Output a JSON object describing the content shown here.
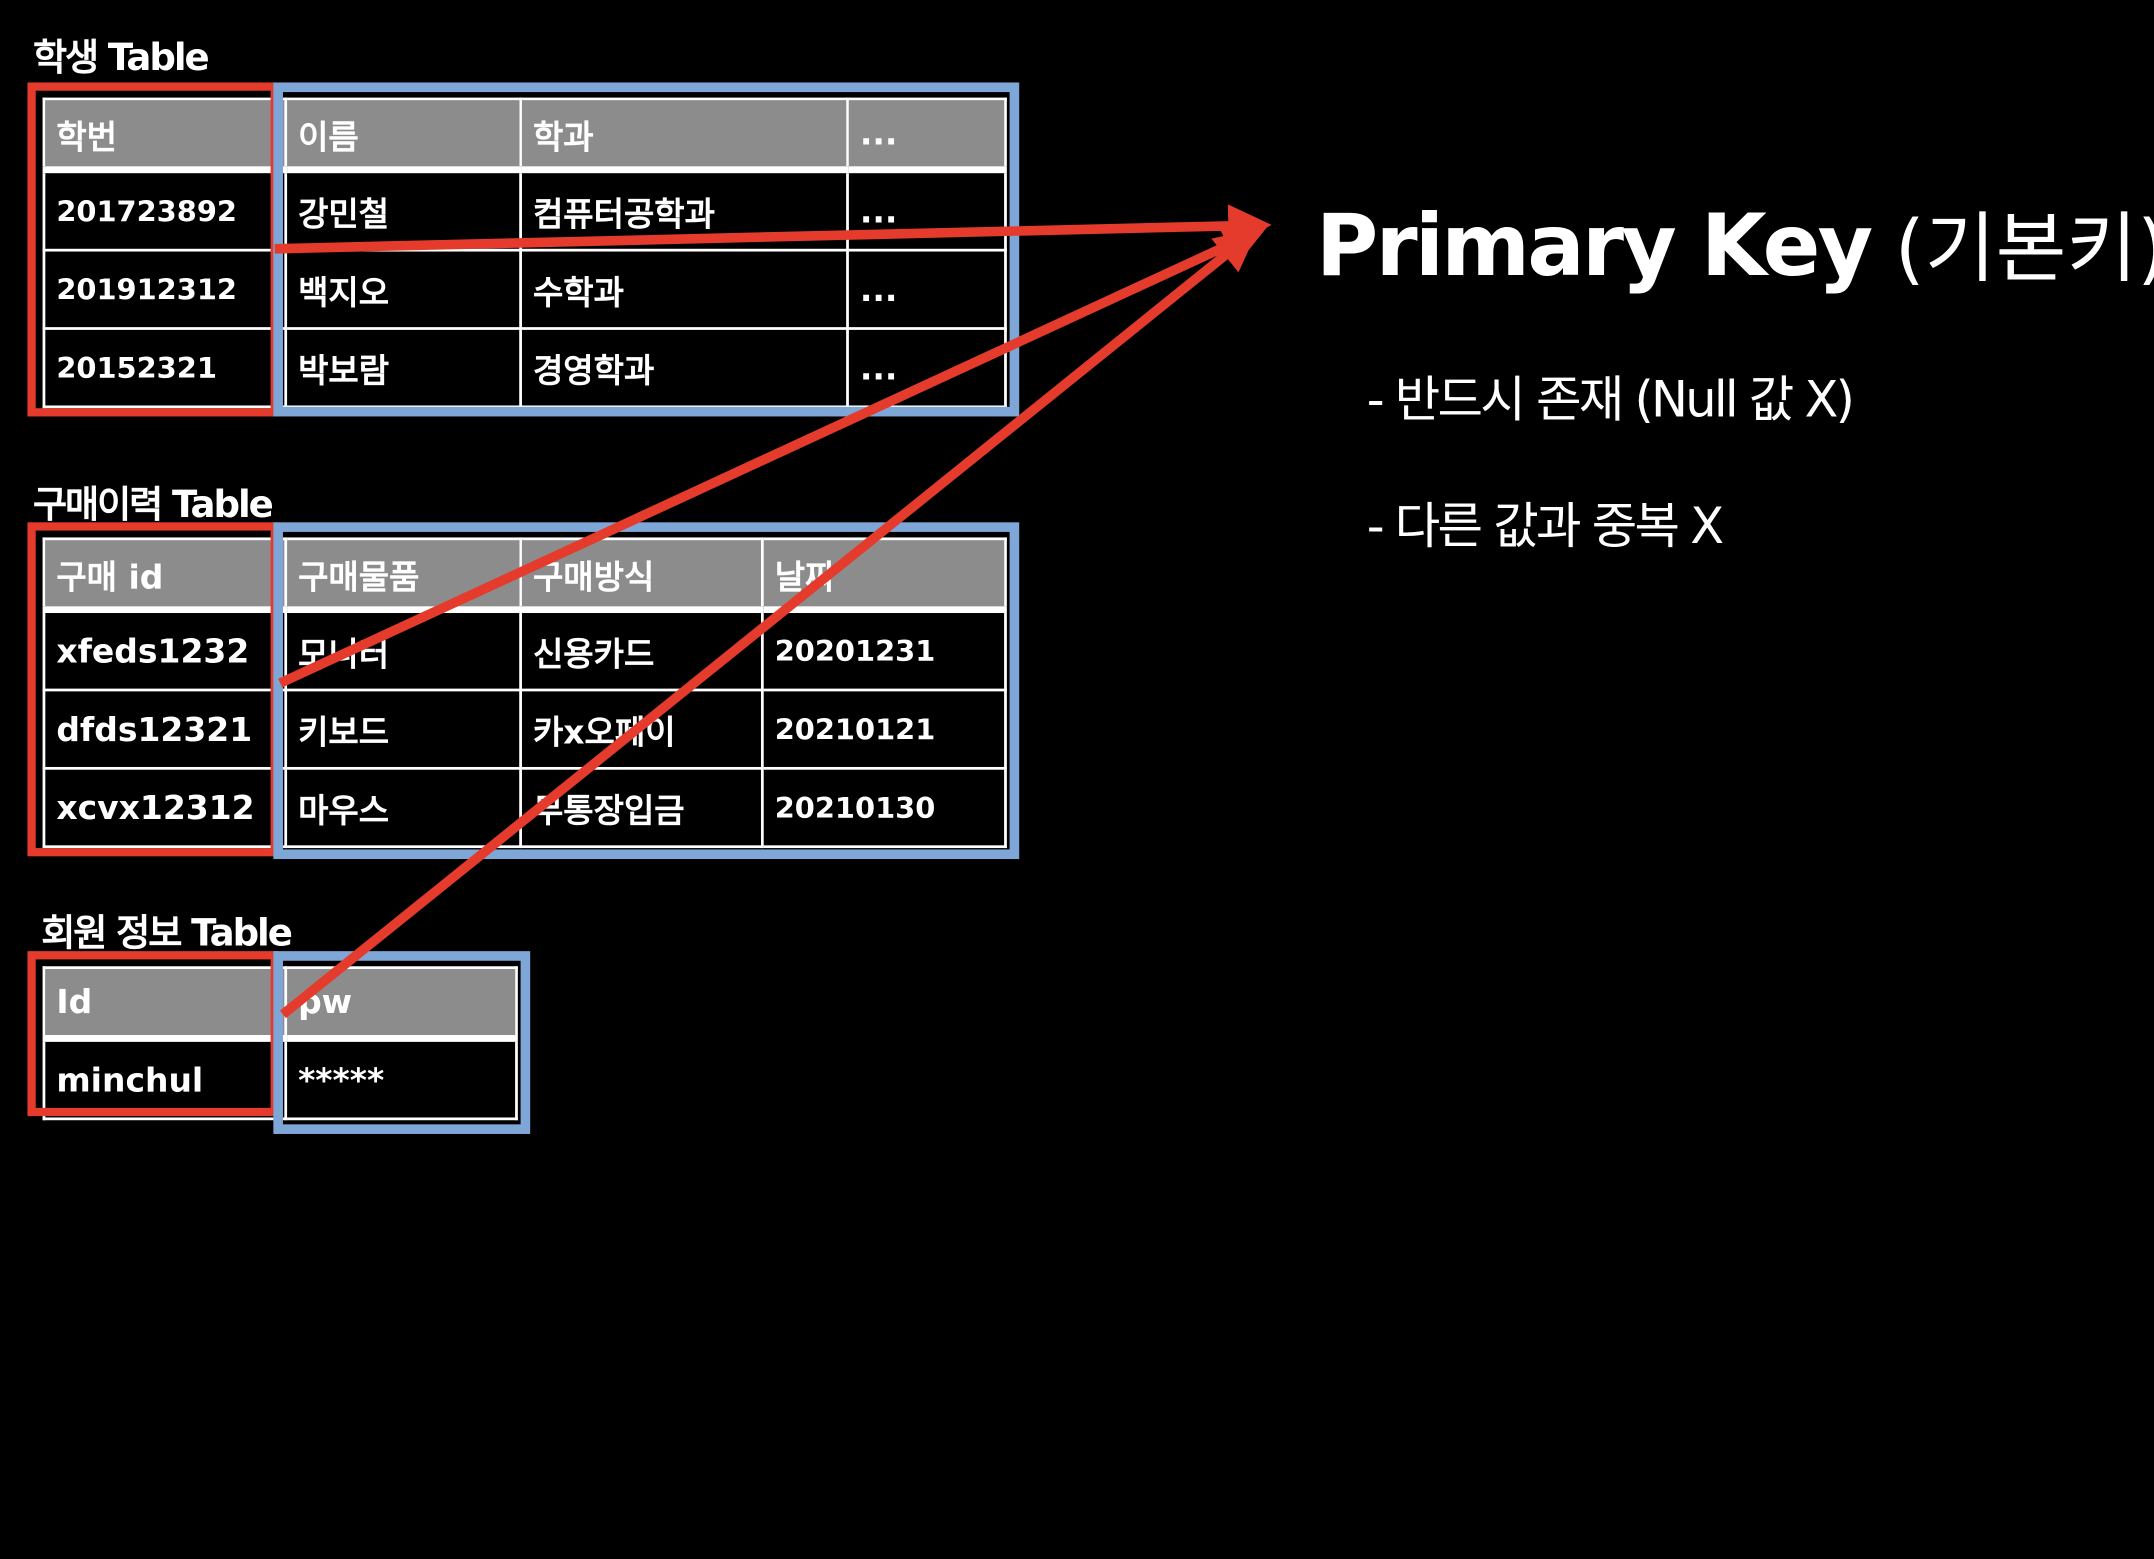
{
  "student_table": {
    "caption": "학생 Table",
    "headers": [
      "학번",
      "이름",
      "학과",
      "..."
    ],
    "rows": [
      [
        "201723892",
        "강민철",
        "컴퓨터공학과",
        "..."
      ],
      [
        "201912312",
        "백지오",
        "수학과",
        "..."
      ],
      [
        "20152321",
        "박보람",
        "경영학과",
        "..."
      ]
    ]
  },
  "purchase_table": {
    "caption": "구매이력 Table",
    "headers": [
      "구매 id",
      "구매물품",
      "구매방식",
      "날짜"
    ],
    "rows": [
      [
        "xfeds1232",
        "모니터",
        "신용카드",
        "20201231"
      ],
      [
        "dfds12321",
        "키보드",
        "카x오페이",
        "20210121"
      ],
      [
        "xcvx12312",
        "마우스",
        "무통장입금",
        "20210130"
      ]
    ]
  },
  "member_table": {
    "caption": "회원 정보 Table",
    "headers": [
      "Id",
      "pw"
    ],
    "rows": [
      [
        "minchul",
        "*****"
      ]
    ]
  },
  "primary_key": {
    "title": "Primary Key",
    "title_korean": "(기본키)",
    "bullets": [
      "- 반드시 존재 (Null 값 X)",
      "- 다른 값과 중복 X"
    ]
  },
  "colors": {
    "key_highlight": "#e53b2c",
    "attribute_highlight": "#7ea6d6",
    "header_fill": "#8c8c8c",
    "arrow": "#e53b2c"
  }
}
